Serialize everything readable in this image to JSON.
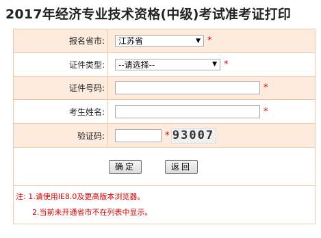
{
  "page": {
    "title": "2017年经济专业技术资格(中级)考试准考证打印"
  },
  "form": {
    "province": {
      "label": "报名省市:",
      "value": "江苏省"
    },
    "cert_type": {
      "label": "证件类型:",
      "value": "--请选择--"
    },
    "cert_no": {
      "label": "证件号码:",
      "value": ""
    },
    "name": {
      "label": "考生姓名:",
      "value": ""
    },
    "captcha": {
      "label": "验证码:",
      "value": "",
      "image_text": "93007"
    },
    "required_mark": "*"
  },
  "buttons": {
    "confirm": "确定",
    "back": "返回"
  },
  "notes": {
    "line1": "注: 1.请使用IE8.0及更高版本浏览器。",
    "line2": "2.当前未开通省市不在列表中显示。"
  },
  "colors": {
    "row_shade": "#fdebdd",
    "border": "#f0c9a8",
    "note_red": "#d40000",
    "required_red": "#e00000"
  }
}
